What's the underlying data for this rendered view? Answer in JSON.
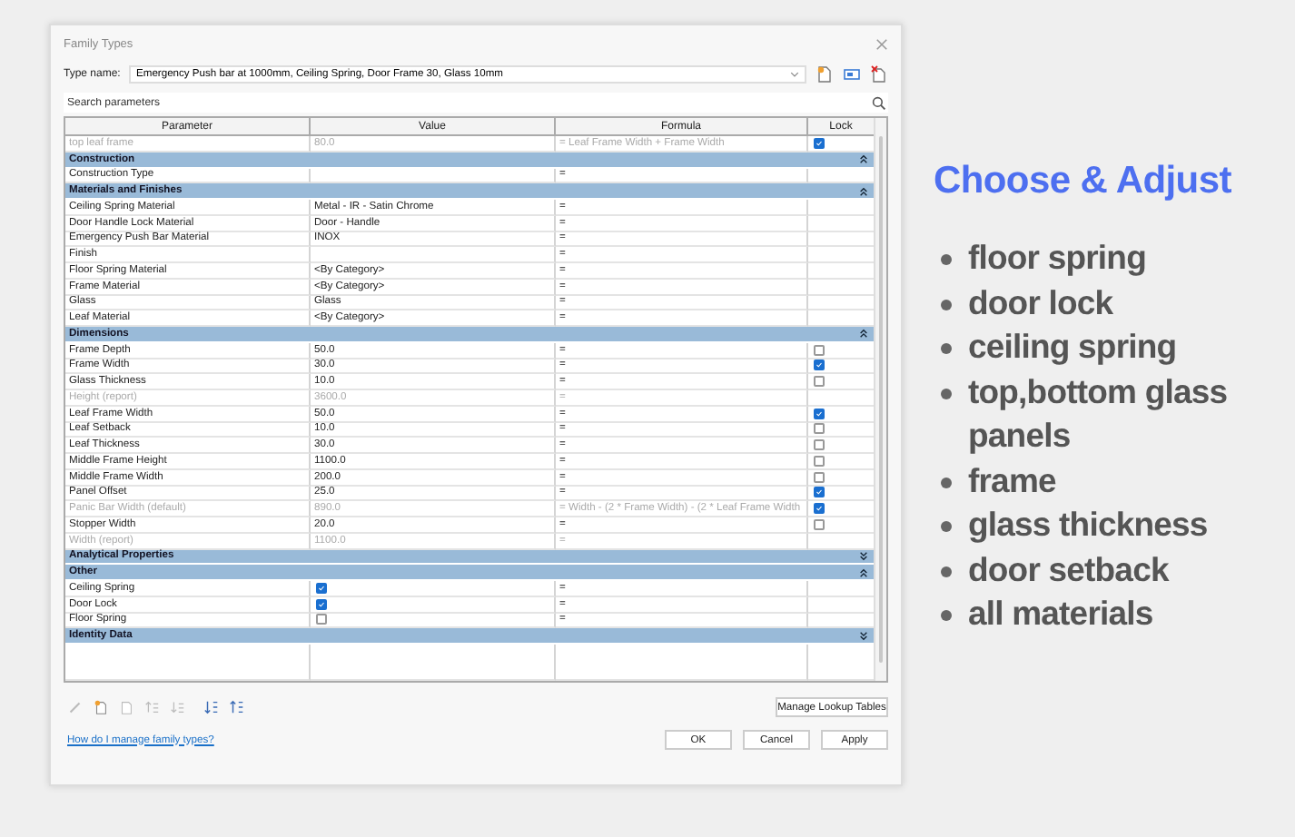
{
  "dialog": {
    "title": "Family Types",
    "type_name_label": "Type name:",
    "type_name": "Emergency Push bar at 1000mm, Ceiling Spring, Door Frame 30, Glass 10mm",
    "search": {
      "placeholder": "Search parameters"
    },
    "columns": [
      "Parameter",
      "Value",
      "Formula",
      "Lock"
    ],
    "rows": [
      {
        "kind": "text",
        "parameter": "top leaf frame",
        "value": "80.0",
        "formula": "= Leaf Frame Width + Frame Width",
        "lock": true,
        "disabled": true
      },
      {
        "kind": "group",
        "label": "Construction",
        "expanded": true
      },
      {
        "kind": "text",
        "parameter": "Construction Type",
        "value": "",
        "formula": "=",
        "disabled": false
      },
      {
        "kind": "group",
        "label": "Materials and Finishes",
        "expanded": true
      },
      {
        "kind": "text",
        "parameter": "Ceiling Spring Material",
        "value": "Metal - IR - Satin Chrome",
        "formula": "=",
        "disabled": false
      },
      {
        "kind": "text",
        "parameter": "Door Handle Lock Material",
        "value": "Door - Handle",
        "formula": "=",
        "disabled": false
      },
      {
        "kind": "text",
        "parameter": "Emergency Push Bar Material",
        "value": "INOX",
        "formula": "=",
        "disabled": false
      },
      {
        "kind": "text",
        "parameter": "Finish",
        "value": "",
        "formula": "=",
        "disabled": false
      },
      {
        "kind": "text",
        "parameter": "Floor Spring Material",
        "value": "<By Category>",
        "formula": "=",
        "disabled": false
      },
      {
        "kind": "text",
        "parameter": "Frame Material",
        "value": "<By Category>",
        "formula": "=",
        "disabled": false
      },
      {
        "kind": "text",
        "parameter": "Glass",
        "value": "Glass",
        "formula": "=",
        "disabled": false
      },
      {
        "kind": "text",
        "parameter": "Leaf Material",
        "value": "<By Category>",
        "formula": "=",
        "disabled": false
      },
      {
        "kind": "group",
        "label": "Dimensions",
        "expanded": true
      },
      {
        "kind": "text",
        "parameter": "Frame Depth",
        "value": "50.0",
        "formula": "=",
        "lock": false,
        "disabled": false
      },
      {
        "kind": "text",
        "parameter": "Frame Width",
        "value": "30.0",
        "formula": "=",
        "lock": true,
        "disabled": false
      },
      {
        "kind": "text",
        "parameter": "Glass Thickness",
        "value": "10.0",
        "formula": "=",
        "lock": false,
        "disabled": false
      },
      {
        "kind": "text",
        "parameter": "Height (report)",
        "value": "3600.0",
        "formula": "=",
        "disabled": true
      },
      {
        "kind": "text",
        "parameter": "Leaf Frame Width",
        "value": "50.0",
        "formula": "=",
        "lock": true,
        "disabled": false
      },
      {
        "kind": "text",
        "parameter": "Leaf Setback",
        "value": "10.0",
        "formula": "=",
        "lock": false,
        "disabled": false
      },
      {
        "kind": "text",
        "parameter": "Leaf Thickness",
        "value": "30.0",
        "formula": "=",
        "lock": false,
        "disabled": false
      },
      {
        "kind": "text",
        "parameter": "Middle Frame Height",
        "value": "1100.0",
        "formula": "=",
        "lock": false,
        "disabled": false
      },
      {
        "kind": "text",
        "parameter": "Middle Frame Width",
        "value": "200.0",
        "formula": "=",
        "lock": false,
        "disabled": false
      },
      {
        "kind": "text",
        "parameter": "Panel Offset",
        "value": "25.0",
        "formula": "=",
        "lock": true,
        "disabled": false
      },
      {
        "kind": "text",
        "parameter": "Panic Bar Width (default)",
        "value": "890.0",
        "formula": "= Width - (2 * Frame Width) - (2 * Leaf Frame Width",
        "lock": true,
        "disabled": true
      },
      {
        "kind": "text",
        "parameter": "Stopper Width",
        "value": "20.0",
        "formula": "=",
        "lock": false,
        "disabled": false
      },
      {
        "kind": "text",
        "parameter": "Width (report)",
        "value": "1100.0",
        "formula": "=",
        "disabled": true
      },
      {
        "kind": "group",
        "label": "Analytical Properties",
        "expanded": false
      },
      {
        "kind": "group",
        "label": "Other",
        "expanded": true
      },
      {
        "kind": "checkbox",
        "parameter": "Ceiling Spring",
        "checked": true,
        "formula": "=",
        "disabled": false
      },
      {
        "kind": "checkbox",
        "parameter": "Door Lock",
        "checked": true,
        "formula": "=",
        "disabled": false
      },
      {
        "kind": "checkbox",
        "parameter": "Floor Spring",
        "checked": false,
        "formula": "=",
        "disabled": false
      },
      {
        "kind": "group",
        "label": "Identity Data",
        "expanded": false
      },
      {
        "kind": "blank"
      }
    ],
    "lookup_button": "Manage Lookup Tables",
    "help_link": "How do I manage family types?",
    "buttons": [
      "OK",
      "Cancel",
      "Apply"
    ]
  },
  "promo": {
    "title": "Choose & Adjust",
    "items": [
      "floor spring",
      "door lock",
      "ceiling spring",
      "top,bottom glass panels",
      "frame",
      "glass thickness",
      "door setback",
      "all materials"
    ]
  }
}
